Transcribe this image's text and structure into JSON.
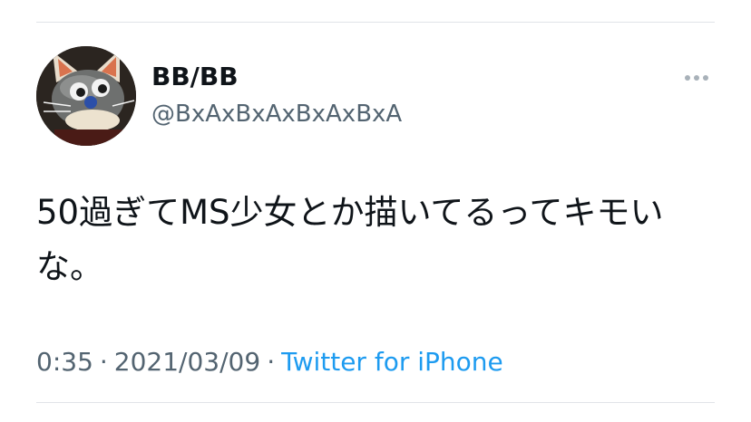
{
  "tweet": {
    "display_name": "BB/BB",
    "handle": "@BxAxBxAxBxAxBxA",
    "text": "50過ぎてMS少女とか描いてるってキモいな。",
    "time": "0:35",
    "separator": "·",
    "date": "2021/03/09",
    "source": "Twitter for iPhone"
  },
  "icons": {
    "more": "more-options-icon",
    "avatar": "profile-avatar"
  },
  "colors": {
    "primary_text": "#0f1419",
    "secondary_text": "#536471",
    "link": "#1d9bf0",
    "divider": "#e1e4e8"
  }
}
